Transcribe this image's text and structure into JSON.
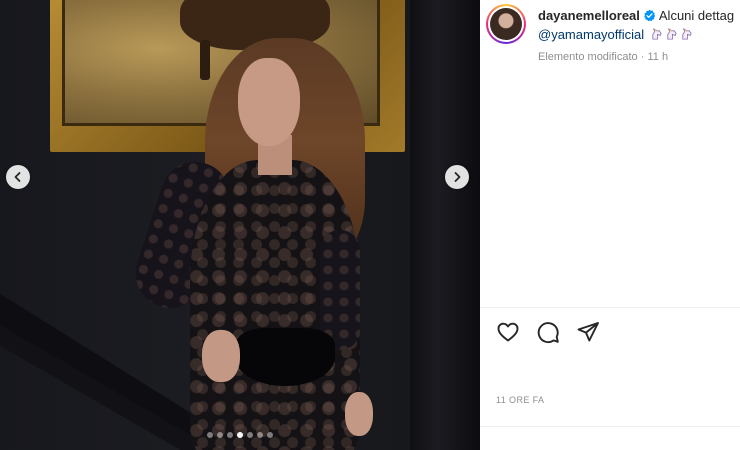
{
  "post": {
    "username": "dayanemelloreal",
    "caption_text": "Alcuni dettag",
    "mention": "@yamamayofficial",
    "edited_label": "Elemento modificato",
    "separator": "·",
    "age": "11 h",
    "timestamp": "11 ORE FA"
  },
  "carousel": {
    "total_slides": 7,
    "active_slide": 4
  },
  "icons": {
    "verified": "verified-badge-icon",
    "emoji": "unicorn-emoji",
    "like": "heart-icon",
    "comment": "comment-bubble-icon",
    "share": "paper-plane-icon",
    "prev": "chevron-left-icon",
    "next": "chevron-right-icon"
  },
  "colors": {
    "verified": "#0095f6",
    "mention": "#00376b",
    "muted": "#8e8e8e",
    "text": "#262626"
  }
}
